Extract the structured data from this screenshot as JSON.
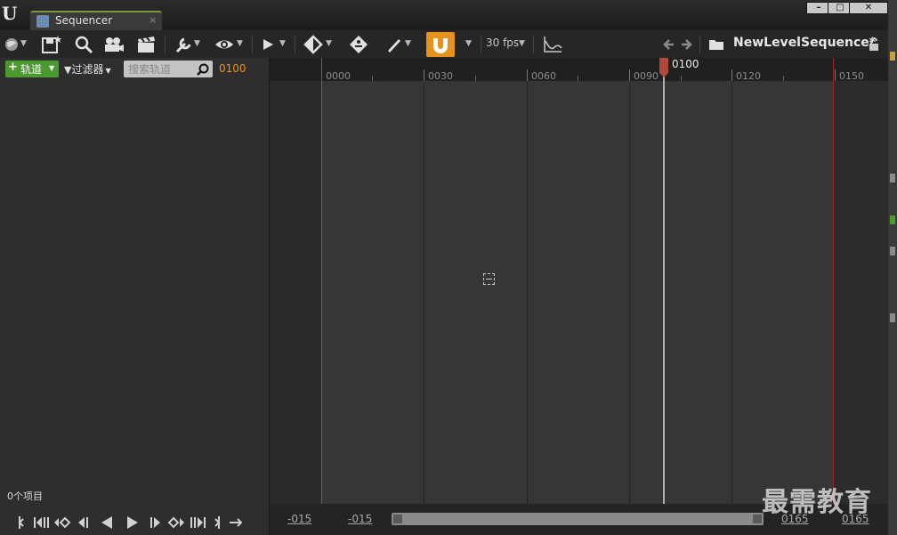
{
  "window": {
    "tab_title": "Sequencer",
    "close_glyph": "×",
    "minimize_glyph": "–",
    "maximize_glyph": "□",
    "close_window_glyph": "✕"
  },
  "toolbar": {
    "fps": "30 fps",
    "sequence_name": "NewLevelSequence*",
    "snap_color": "#e8921e"
  },
  "left_panel": {
    "add_track_label": "轨道",
    "filter_label": "过滤器",
    "search_placeholder": "搜索轨道",
    "current_frame": "0100",
    "item_count": "0个项目"
  },
  "timeline": {
    "ticks": [
      "0000",
      "0030",
      "0060",
      "0090",
      "0120",
      "0150"
    ],
    "playhead_frame": "0100",
    "view_start": "-015",
    "working_start": "-015",
    "working_end": "0165",
    "view_end": "0165",
    "start_color": "#2d8a2d",
    "end_color": "#9a2a2a"
  },
  "watermark": "最需教育"
}
